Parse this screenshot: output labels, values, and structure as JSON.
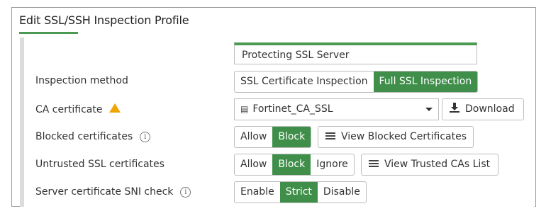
{
  "window": {
    "title": "Edit SSL/SSH Inspection Profile"
  },
  "profile": {
    "name_value": "Protecting SSL Server"
  },
  "inspection_method": {
    "label": "Inspection method",
    "options": [
      "SSL Certificate Inspection",
      "Full SSL Inspection"
    ],
    "selected": "Full SSL Inspection"
  },
  "ca_certificate": {
    "label": "CA certificate",
    "value": "Fortinet_CA_SSL",
    "icon": "certificate-icon",
    "download_label": "Download",
    "warning_color": "#f0a500"
  },
  "blocked_certificates": {
    "label": "Blocked certificates",
    "options": [
      "Allow",
      "Block"
    ],
    "selected": "Block",
    "view_label": "View Blocked Certificates"
  },
  "untrusted_certificates": {
    "label": "Untrusted SSL certificates",
    "options": [
      "Allow",
      "Block",
      "Ignore"
    ],
    "selected": "Block",
    "view_label": "View Trusted CAs List"
  },
  "sni_check": {
    "label": "Server certificate SNI check",
    "options": [
      "Enable",
      "Strict",
      "Disable"
    ],
    "selected": "Strict"
  },
  "colors": {
    "accent": "#3f8f4a",
    "border": "#bdbdbd"
  }
}
